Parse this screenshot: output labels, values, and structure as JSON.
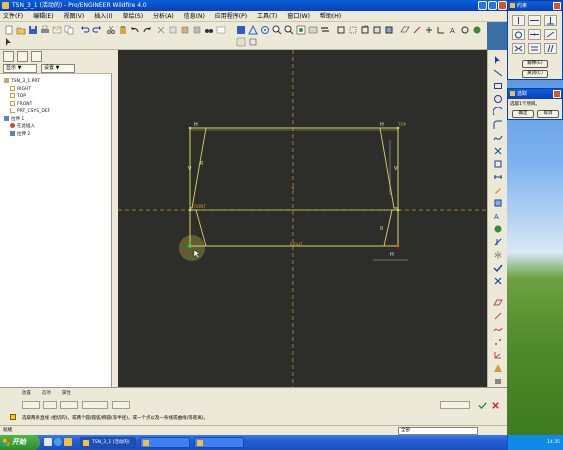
{
  "window": {
    "title": "TSN_3_1 (活动的) - Pro/ENGINEER Wildfire 4.0"
  },
  "menu": {
    "items": [
      "文件(F)",
      "编辑(E)",
      "视图(V)",
      "插入(I)",
      "草绘(S)",
      "分析(A)",
      "信息(N)",
      "应用程序(P)",
      "工具(T)",
      "窗口(W)",
      "帮助(H)"
    ]
  },
  "left_panel": {
    "dropdown_show": "显示 ▼",
    "dropdown_settings": "设置 ▼",
    "tree": [
      {
        "label": "TSN_3_1.PRT",
        "icon": "part-icon"
      },
      {
        "label": "RIGHT",
        "icon": "datum-plane-icon"
      },
      {
        "label": "TOP",
        "icon": "datum-plane-icon"
      },
      {
        "label": "FRONT",
        "icon": "datum-plane-icon"
      },
      {
        "label": "PRT_CSYS_DEF",
        "icon": "csys-icon"
      },
      {
        "label": "拉伸 1",
        "icon": "extrude-icon"
      },
      {
        "label": "在此插入",
        "icon": "insert-here-icon"
      },
      {
        "label": "拉伸 2",
        "icon": "extrude-icon"
      }
    ]
  },
  "canvas": {
    "bg_color": "#2d2d2a",
    "sketch_color": "#d9d36a",
    "centerline_color": "#c8963c",
    "labels": {
      "h_top_left": "H",
      "h_top_right": "H",
      "h_bottom_right": "H",
      "v_left": "V",
      "v_right": "V",
      "right_label": "RIGHT",
      "front_label": "FRONT",
      "top_label_left": "TOP",
      "top_label_right": "TOP",
      "dim_left": "R",
      "dim_right": "R"
    }
  },
  "dashboard": {
    "tabs": [
      "放置",
      "选项",
      "属性"
    ],
    "message": "选取两条直线 (相切的)，或两个圆/圆弧/椭圆(等半径)，或一个点以及一条线或曲线(等距离)。"
  },
  "statusbar": {
    "left_text": "就绪",
    "filter_value": "全部"
  },
  "taskbar": {
    "start_label": "开始",
    "tasks": [
      {
        "label": "TSN_3_1 (活动的)",
        "active": true
      },
      {
        "label": "",
        "active": false
      },
      {
        "label": "",
        "active": false
      }
    ],
    "clock": "14:35"
  },
  "constraint_panel": {
    "title": "约束",
    "close_button": "关闭(C)",
    "explain_button": "解释(E)"
  },
  "select_panel": {
    "title": "选取",
    "message": "选取1个项目。",
    "ok_button": "确定",
    "cancel_button": "取消"
  }
}
